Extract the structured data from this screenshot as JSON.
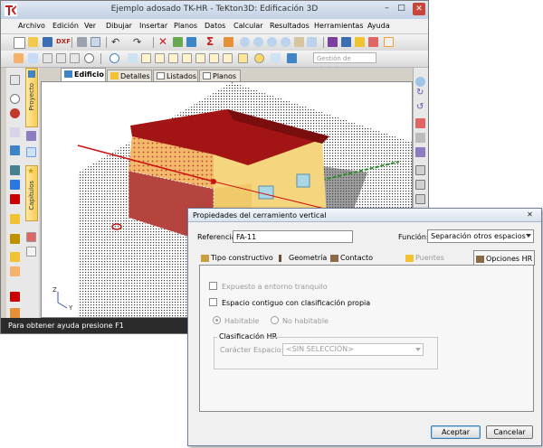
{
  "window": {
    "title": "Ejemplo adosado TK-HR - TeKton3D: Edificación 3D",
    "minimize": "–",
    "maximize": "□",
    "close": "✕"
  },
  "menu": [
    "Archivo",
    "Edición",
    "Ver",
    "Dibujar",
    "Insertar",
    "Planos",
    "Datos",
    "Calcular",
    "Resultados",
    "Herramientas",
    "Ayuda"
  ],
  "toolbar": {
    "dxf_label": "DXF",
    "symbol_search_placeholder": "Gestión de símbolos..."
  },
  "side_tabs": [
    "Proyecto",
    "Capítulos"
  ],
  "main_tabs": [
    "Edificio",
    "Detalles",
    "Listados",
    "Planos"
  ],
  "viewport": {
    "axis_z": "Z",
    "axis_y": "Y"
  },
  "status": {
    "text": "Para obtener ayuda presione F1"
  },
  "dialog": {
    "title": "Propiedades del cerramiento vertical",
    "close": "✕",
    "referencia_label": "Referencia:",
    "referencia_value": "FA-11",
    "funcion_label": "Función:",
    "funcion_value": "Separación otros espacios",
    "tabs": [
      "Tipo constructivo",
      "Geometría",
      "Contacto terreno",
      "Puentes térmicos",
      "Opciones HR"
    ],
    "options": {
      "expuesto": "Expuesto a entorno tranquilo",
      "espacio_contiguo": "Espacio contiguo con clasificación propia",
      "habitable": "Habitable",
      "no_habitable": "No habitable",
      "group_title": "Clasificación HR",
      "caracter_label": "Carácter Espacio:",
      "caracter_value": "<SIN SELECCIÓN>"
    },
    "buttons": {
      "accept": "Aceptar",
      "cancel": "Cancelar"
    }
  },
  "colors": {
    "roof": "#a31515",
    "wall": "#f5d57e",
    "wall_shadow": "#b5443f",
    "ground_line": "#2e8b2e",
    "axis_line": "#cc1111"
  }
}
